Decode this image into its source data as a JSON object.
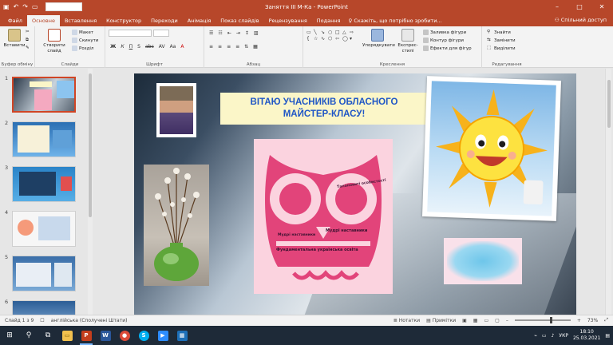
{
  "window": {
    "title": "Заняття III М-Ка - PowerPoint",
    "controls": [
      "–",
      "□",
      "✕"
    ]
  },
  "quick_access": {
    "save_icon": "save-icon",
    "undo_icon": "undo-icon",
    "redo_icon": "redo-icon",
    "present_icon": "present-icon"
  },
  "tabs": [
    {
      "label": "Файл"
    },
    {
      "label": "Основне",
      "active": true
    },
    {
      "label": "Вставлення"
    },
    {
      "label": "Конструктор"
    },
    {
      "label": "Переходи"
    },
    {
      "label": "Анімація"
    },
    {
      "label": "Показ слайдів"
    },
    {
      "label": "Рецензування"
    },
    {
      "label": "Подання"
    }
  ],
  "tell_me": "Скажіть, що потрібно зробити...",
  "share": "Спільний доступ",
  "ribbon": {
    "clipboard": {
      "label": "Буфер обміну",
      "paste": "Вставити"
    },
    "slides": {
      "label": "Слайди",
      "new_slide": "Створити слайд",
      "layout": "Макет",
      "reset": "Скинути",
      "section": "Розділ"
    },
    "font": {
      "label": "Шрифт",
      "buttons": [
        "Ж",
        "К",
        "П",
        "S",
        "abc",
        "AV",
        "Аа",
        "A"
      ]
    },
    "paragraph": {
      "label": "Абзац"
    },
    "drawing": {
      "label": "Креслення",
      "arrange": "Упорядкувати",
      "styles": "Експрес-стилі",
      "fill": "Заливка фігури",
      "outline": "Контур фігури",
      "effects": "Ефекти для фігур"
    },
    "editing": {
      "label": "Редагування",
      "find": "Знайти",
      "replace": "Замінити",
      "select": "Виділити"
    }
  },
  "thumbnails": [
    {
      "num": "1",
      "selected": true
    },
    {
      "num": "2"
    },
    {
      "num": "3"
    },
    {
      "num": "4"
    },
    {
      "num": "5"
    },
    {
      "num": "6"
    }
  ],
  "slide": {
    "title_line1": "ВІТАЮ УЧАСНИКІВ ОБЛАСНОГО",
    "title_line2": "МАЙСТЕР-КЛАСУ!",
    "owl_text": {
      "a": "Талановиті особистості",
      "b": "Мудрі наставники",
      "c": "Фундаментальна українська освіта",
      "d": "Мудрі наставники"
    }
  },
  "status": {
    "slide": "Слайд 1 з 9",
    "language": "англійська (Сполучені Штати)",
    "notes": "Нотатки",
    "comments": "Примітки",
    "zoom": "73%"
  },
  "taskbar": {
    "lang": "УКР",
    "time": "18:10",
    "date": "25.03.2021"
  },
  "colors": {
    "accent": "#b7472a",
    "title_text": "#1f56c6",
    "title_bg": "#fbf6c8",
    "owl_bg": "#fbd3df",
    "owl_shape": "#e2447a"
  }
}
